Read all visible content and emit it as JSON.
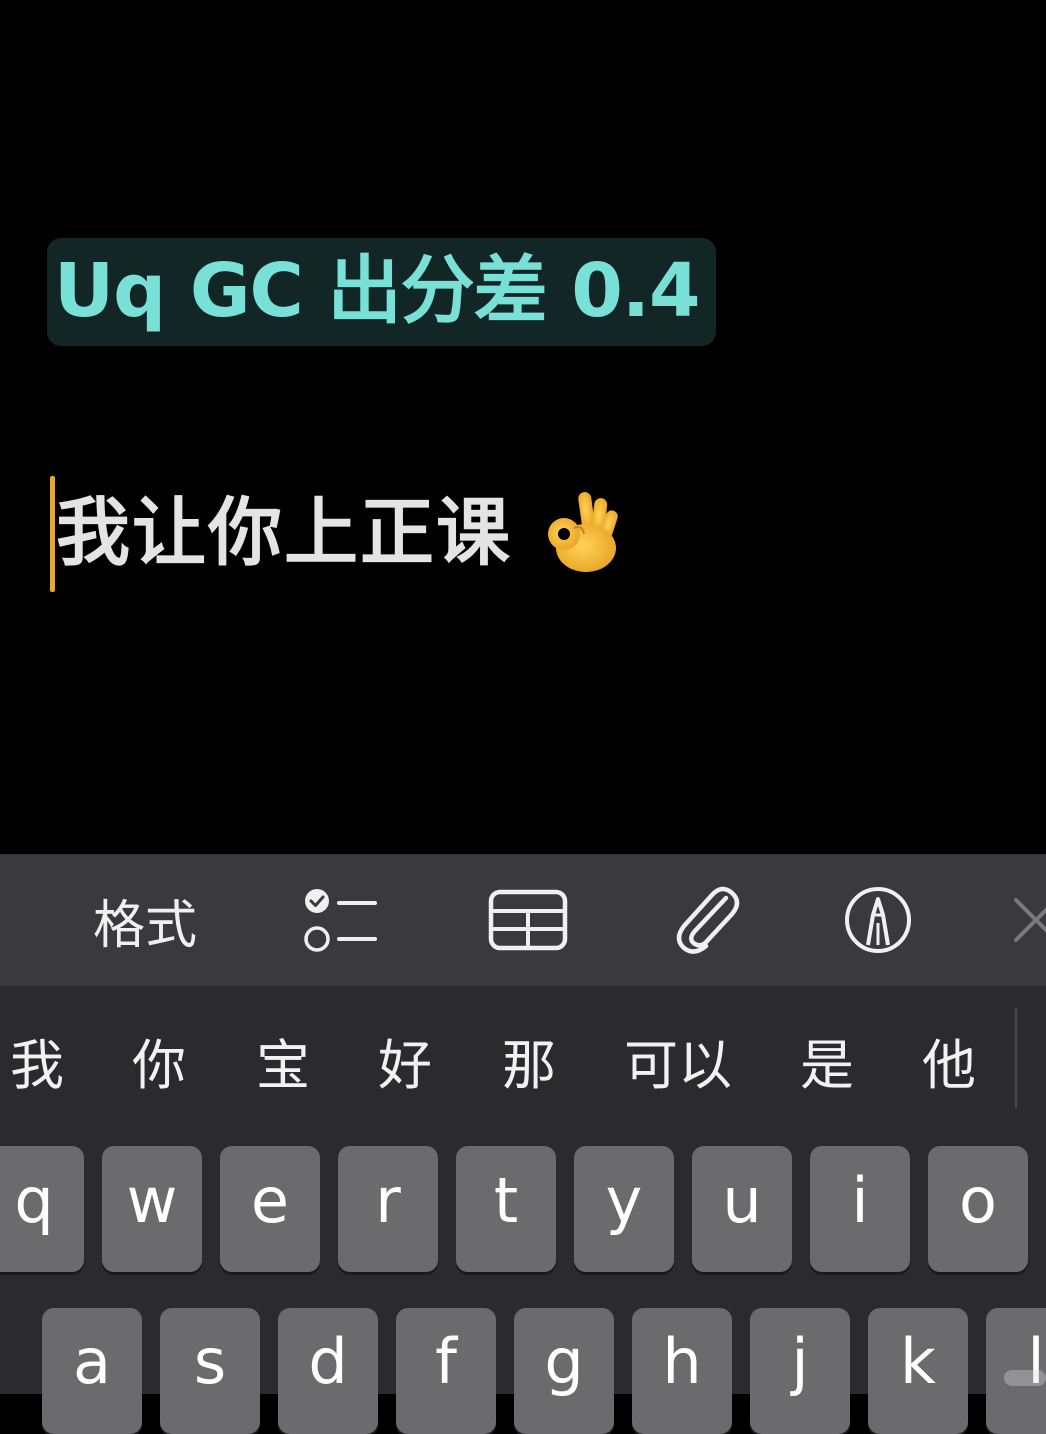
{
  "note": {
    "heading": "Uq GC 出分差 0.4",
    "body_text": "我让你上正课",
    "body_emoji_name": "ok-hand-emoji",
    "heading_color": "#79e0d8",
    "heading_highlight_color": "#132626",
    "cursor_color": "#e0a93a"
  },
  "toolbar": {
    "format_label": "格式",
    "icons": [
      "checklist-icon",
      "table-icon",
      "paperclip-icon",
      "markup-pen-icon",
      "close-icon"
    ]
  },
  "keyboard": {
    "candidates": [
      "我",
      "你",
      "宝",
      "好",
      "那",
      "可以",
      "是",
      "他"
    ],
    "row1": [
      "q",
      "w",
      "e",
      "r",
      "t",
      "y",
      "u",
      "i",
      "o"
    ],
    "row2": [
      "a",
      "s",
      "d",
      "f",
      "g",
      "h",
      "j",
      "k",
      "l"
    ]
  }
}
